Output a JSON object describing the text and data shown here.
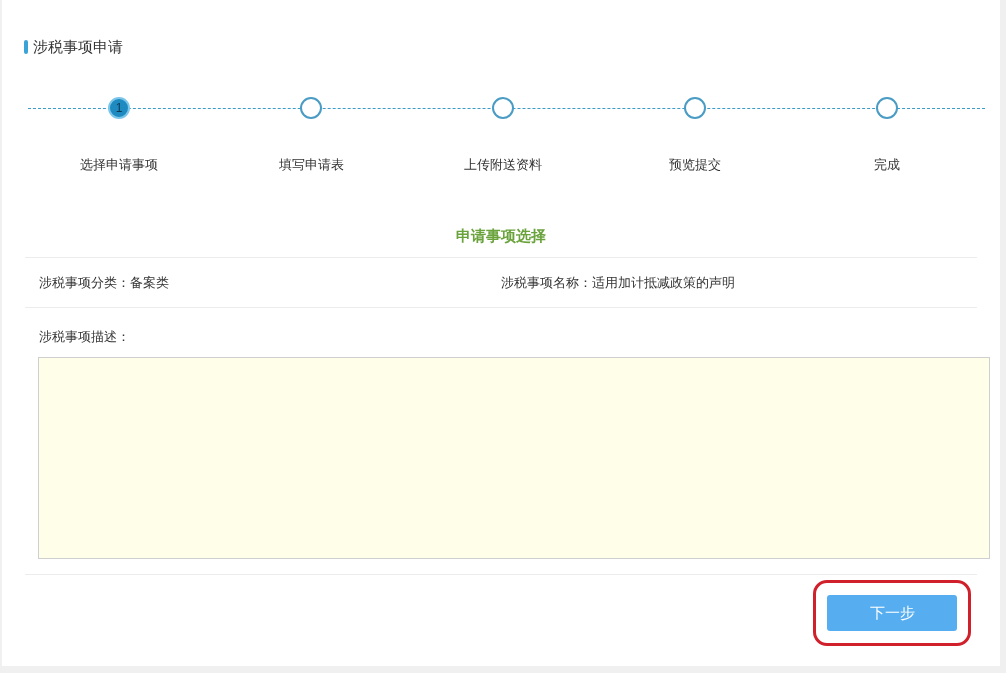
{
  "title": "涉税事项申请",
  "steps": [
    {
      "label": "选择申请事项",
      "marker": "1",
      "selected": true
    },
    {
      "label": "填写申请表",
      "selected": false
    },
    {
      "label": "上传附送资料",
      "selected": false
    },
    {
      "label": "预览提交",
      "selected": false
    },
    {
      "label": "完成",
      "selected": false
    }
  ],
  "section_title": "申请事项选择",
  "fields": [
    {
      "label": "涉税事项分类：",
      "value": "备案类"
    },
    {
      "label": "涉税事项名称：",
      "value": "适用加计抵减政策的声明"
    }
  ],
  "description": {
    "label": "涉税事项描述："
  },
  "next_button": "下一步"
}
